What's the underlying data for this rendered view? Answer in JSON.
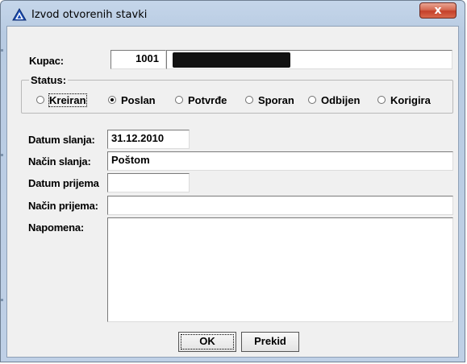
{
  "window": {
    "title": "Izvod otvorenih stavki",
    "close_symbol": "x"
  },
  "form": {
    "kupac_label": "Kupac:",
    "kupac_code": "1001",
    "status_label": "Status:",
    "status_options": [
      {
        "label": "Kreiran",
        "selected": false
      },
      {
        "label": "Poslan",
        "selected": true
      },
      {
        "label": "Potvrđe",
        "selected": false
      },
      {
        "label": "Sporan",
        "selected": false
      },
      {
        "label": "Odbijen",
        "selected": false
      },
      {
        "label": "Korigira",
        "selected": false
      }
    ],
    "datum_slanja_label": "Datum slanja:",
    "datum_slanja_value": "31.12.2010",
    "nacin_slanja_label": "Način slanja:",
    "nacin_slanja_value": "Poštom",
    "datum_prijema_label": "Datum prijema",
    "datum_prijema_value": "",
    "nacin_prijema_label": "Način prijema:",
    "nacin_prijema_value": "",
    "napomena_label": "Napomena:",
    "napomena_value": ""
  },
  "buttons": {
    "ok": "OK",
    "prekid": "Prekid"
  },
  "icons": {
    "app": "warning-triangle-icon",
    "close": "close-icon"
  }
}
